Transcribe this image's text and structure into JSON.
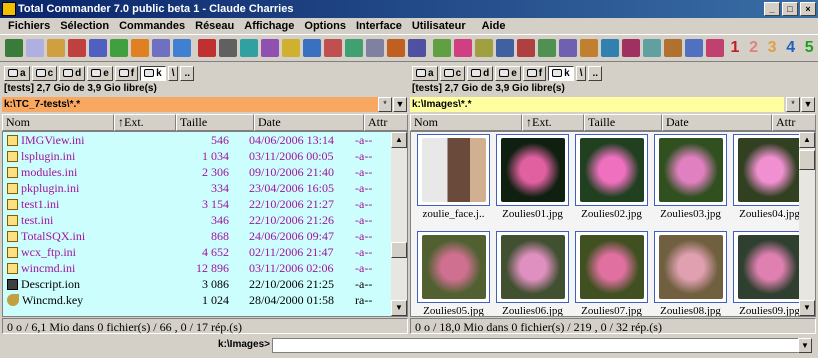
{
  "window": {
    "title": "Total Commander 7.0 public beta 1 - Claude Charries",
    "min": "_",
    "max": "□",
    "close": "×"
  },
  "menu": [
    "Fichiers",
    "Sélection",
    "Commandes",
    "Réseau",
    "Affichage",
    "Options",
    "Interface",
    "Utilisateur",
    "Aide"
  ],
  "toolbar": {
    "nums": [
      "1",
      "2",
      "3",
      "4",
      "5"
    ],
    "colors": [
      "#3a7a3a",
      "#b0b0e0",
      "#d0a040",
      "#c04040",
      "#5060c0",
      "#40a040",
      "#e08020",
      "#7070c0",
      "#4080d0",
      "#c03030",
      "#606060",
      "#30a0a0",
      "#9050b0",
      "#d0b030",
      "#3a70c0",
      "#c05050",
      "#40a070",
      "#8080a0",
      "#c06020",
      "#5050a0",
      "#60a040",
      "#d04080",
      "#a0a040",
      "#4060a0",
      "#b04040",
      "#509050",
      "#7060b0",
      "#c08030",
      "#3080b0",
      "#a03060",
      "#60a0a0",
      "#b07030",
      "#5070c0",
      "#c04070"
    ]
  },
  "left": {
    "drives": [
      "a",
      "c",
      "d",
      "e",
      "f",
      "k",
      "\\",
      ".."
    ],
    "active_drive": "k",
    "info": "[tests]  2,7 Gio de 3,9 Gio libre(s)",
    "path": "k:\\TC_7-tests\\*.*",
    "path_btns": [
      "*",
      "▼"
    ],
    "columns": [
      "Nom",
      "↑Ext.",
      "Taille",
      "Date",
      "Attr"
    ],
    "files": [
      {
        "name": "IMGView.ini",
        "size": "546",
        "date": "04/06/2006 13:14",
        "attr": "-a--",
        "color": "pink",
        "icon": "ini"
      },
      {
        "name": "lsplugin.ini",
        "size": "1 034",
        "date": "03/11/2006 00:05",
        "attr": "-a--",
        "color": "pink",
        "icon": "ini"
      },
      {
        "name": "modules.ini",
        "size": "2 306",
        "date": "09/10/2006 21:40",
        "attr": "-a--",
        "color": "pink",
        "icon": "ini"
      },
      {
        "name": "pkplugin.ini",
        "size": "334",
        "date": "23/04/2006 16:05",
        "attr": "-a--",
        "color": "pink",
        "icon": "ini"
      },
      {
        "name": "test1.ini",
        "size": "3 154",
        "date": "22/10/2006 21:27",
        "attr": "-a--",
        "color": "pink",
        "icon": "ini"
      },
      {
        "name": "test.ini",
        "size": "346",
        "date": "22/10/2006 21:26",
        "attr": "-a--",
        "color": "pink",
        "icon": "ini"
      },
      {
        "name": "TotalSQX.ini",
        "size": "868",
        "date": "24/06/2006 09:47",
        "attr": "-a--",
        "color": "pink",
        "icon": "ini"
      },
      {
        "name": "wcx_ftp.ini",
        "size": "4 652",
        "date": "02/11/2006 21:47",
        "attr": "-a--",
        "color": "pink",
        "icon": "ini"
      },
      {
        "name": "wincmd.ini",
        "size": "12 896",
        "date": "03/11/2006 02:06",
        "attr": "-a--",
        "color": "pink",
        "icon": "ini"
      },
      {
        "name": "Descript.ion",
        "size": "3 086",
        "date": "22/10/2006 21:25",
        "attr": "-a--",
        "color": "black",
        "icon": "ion"
      },
      {
        "name": "Wincmd.key",
        "size": "1 024",
        "date": "28/04/2000 01:58",
        "attr": "ra--",
        "color": "black",
        "icon": "key"
      }
    ],
    "status": "0 o / 6,1 Mio dans 0 fichier(s) / 66 , 0 / 17 rép.(s)"
  },
  "right": {
    "drives": [
      "a",
      "c",
      "d",
      "e",
      "f",
      "k",
      "\\",
      ".."
    ],
    "active_drive": "k",
    "info": "[tests]  2,7 Gio de 3,9 Gio libre(s)",
    "path": "k:\\Images\\*.*",
    "path_btns": [
      "*",
      "▼"
    ],
    "columns": [
      "Nom",
      "↑Ext.",
      "Taille",
      "Date",
      "Attr"
    ],
    "thumbs": [
      {
        "label": "zoulie_face.j..",
        "c1": "#6a4a3a",
        "c2": "#d0b090"
      },
      {
        "label": "Zoulies01.jpg",
        "c1": "#102010",
        "c2": "#e060a0"
      },
      {
        "label": "Zoulies02.jpg",
        "c1": "#204020",
        "c2": "#f070c0"
      },
      {
        "label": "Zoulies03.jpg",
        "c1": "#305020",
        "c2": "#e080c0"
      },
      {
        "label": "Zoulies04.jpg",
        "c1": "#304020",
        "c2": "#f090d0"
      },
      {
        "label": "Zoulies05.jpg",
        "c1": "#506030",
        "c2": "#d07090"
      },
      {
        "label": "Zoulies06.jpg",
        "c1": "#405030",
        "c2": "#e090c0"
      },
      {
        "label": "Zoulies07.jpg",
        "c1": "#405020",
        "c2": "#e070a0"
      },
      {
        "label": "Zoulies08.jpg",
        "c1": "#706040",
        "c2": "#e0a0b0"
      },
      {
        "label": "Zoulies09.jpg",
        "c1": "#304030",
        "c2": "#e080b0"
      }
    ],
    "status": "0 o / 18,0 Mio dans 0 fichier(s) / 219 , 0 / 32 rép.(s)"
  },
  "cmd": {
    "prompt": "k:\\Images>",
    "value": ""
  }
}
